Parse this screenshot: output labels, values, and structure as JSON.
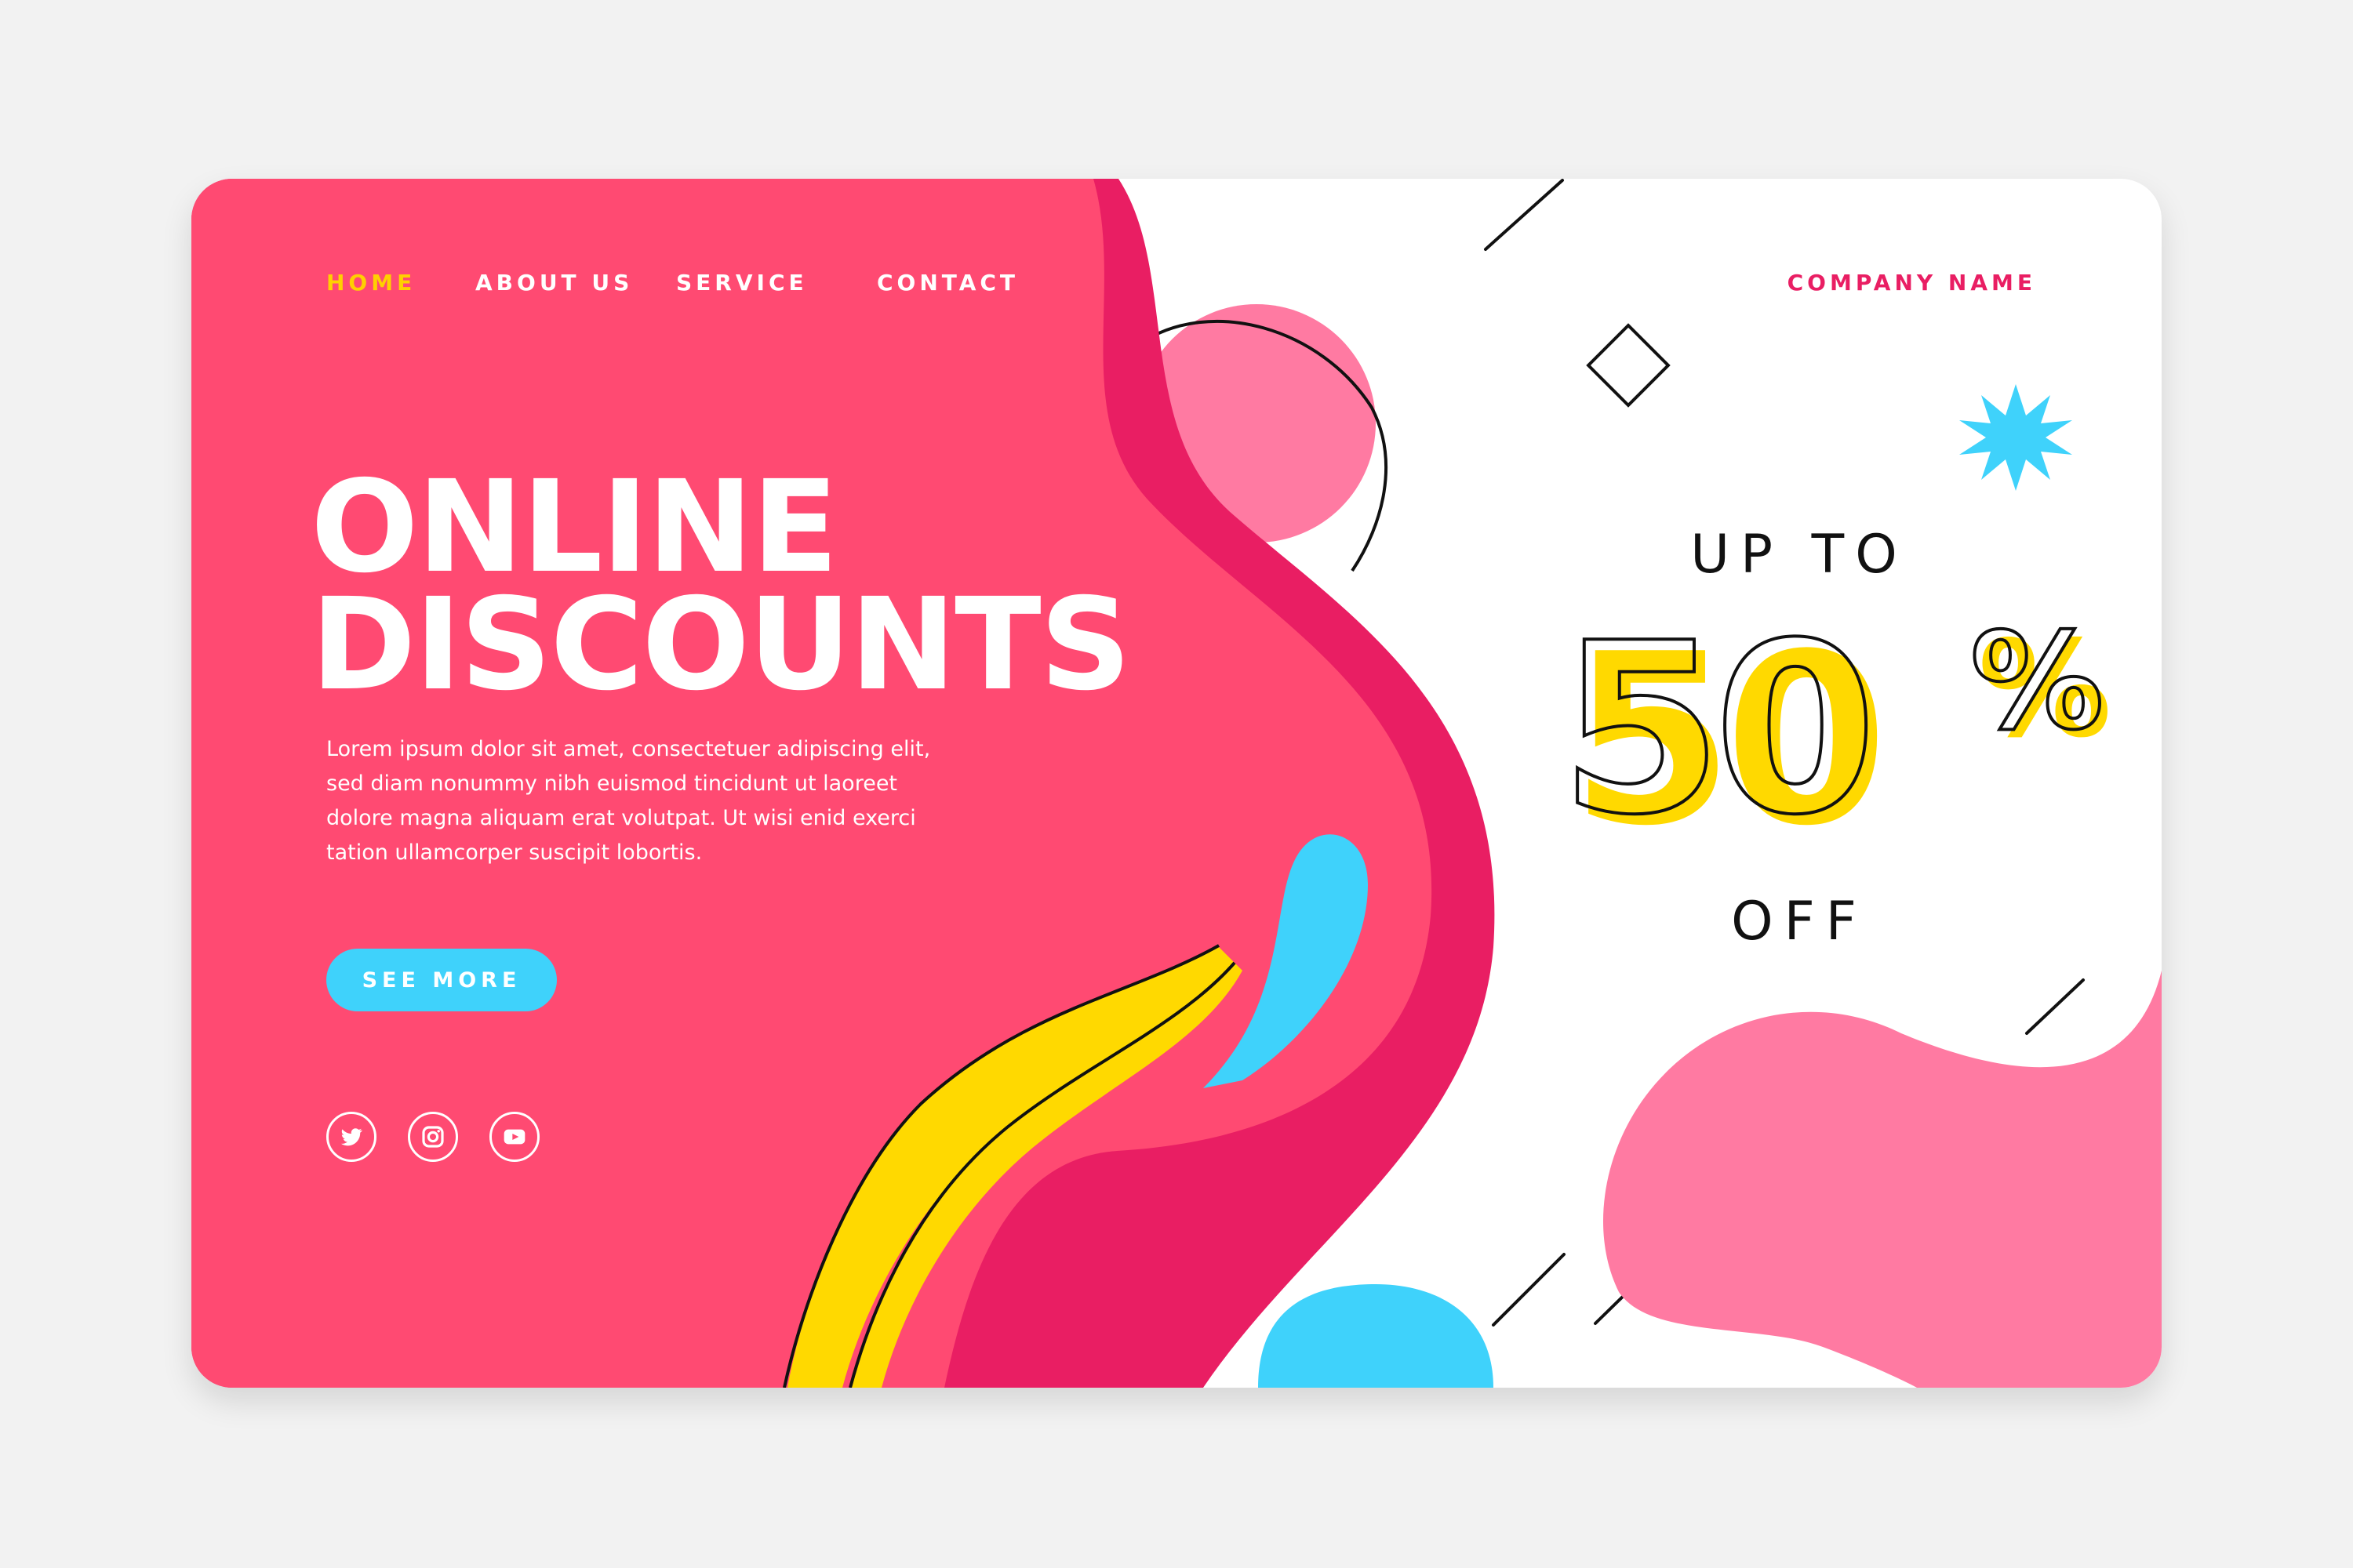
{
  "nav": {
    "items": [
      {
        "label": "HOME",
        "active": true
      },
      {
        "label": "ABOUT US",
        "active": false
      },
      {
        "label": "SERVICE",
        "active": false
      },
      {
        "label": "CONTACT",
        "active": false
      }
    ]
  },
  "header": {
    "company_name": "COMPANY NAME"
  },
  "hero": {
    "title_line1": "ONLINE",
    "title_line2": "DISCOUNTS",
    "description": "Lorem ipsum dolor sit amet, consectetuer adipiscing elit, sed diam nonummy nibh euismod tincidunt ut laoreet dolore magna aliquam erat volutpat. Ut wisi enid exerci tation ullamcorper suscipit lobortis.",
    "cta_label": "SEE MORE"
  },
  "social": [
    "twitter-icon",
    "instagram-icon",
    "youtube-icon"
  ],
  "promo": {
    "up_to": "UP TO",
    "amount": "50",
    "percent_sign": "%",
    "off": "OFF"
  },
  "colors": {
    "pink": "#ff4a72",
    "deep_pink": "#e91e63",
    "light_pink": "#ff7aa2",
    "yellow": "#ffd900",
    "cyan": "#3fd2fb",
    "nav_active": "#ffd000",
    "company": "#e91e63"
  }
}
